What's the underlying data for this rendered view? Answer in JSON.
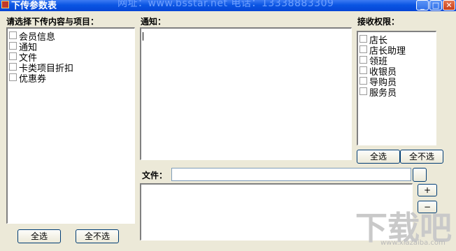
{
  "window": {
    "title": "下传参数表",
    "watermark": "网址：www.bsstar.net 电话：13338883309"
  },
  "left_panel": {
    "label": "请选择下传内容与项目：",
    "items": [
      {
        "label": "会员信息",
        "checked": false
      },
      {
        "label": "通知",
        "checked": false
      },
      {
        "label": "文件",
        "checked": false
      },
      {
        "label": "卡类项目折扣",
        "checked": false
      },
      {
        "label": "优惠券",
        "checked": false
      }
    ],
    "select_all": "全选",
    "select_none": "全不选"
  },
  "notice": {
    "label": "通知：",
    "value": ""
  },
  "file": {
    "label": "文件：",
    "path_value": "",
    "browse_label": "",
    "add_label": "+",
    "remove_label": "−"
  },
  "permissions": {
    "label": "接收权限：",
    "items": [
      {
        "label": "店长",
        "checked": false
      },
      {
        "label": "店长助理",
        "checked": false
      },
      {
        "label": "领班",
        "checked": false
      },
      {
        "label": "收银员",
        "checked": false
      },
      {
        "label": "导购员",
        "checked": false
      },
      {
        "label": "服务员",
        "checked": false
      }
    ],
    "select_all": "全选",
    "select_none": "全不选"
  },
  "logo": {
    "chars": [
      "下",
      "载",
      "吧"
    ],
    "site": "www.xiazaiba.com"
  },
  "colors": {
    "titlebar": "#0a55e3",
    "dialog_bg": "#ece9d8",
    "list_bg": "#ffffff"
  }
}
